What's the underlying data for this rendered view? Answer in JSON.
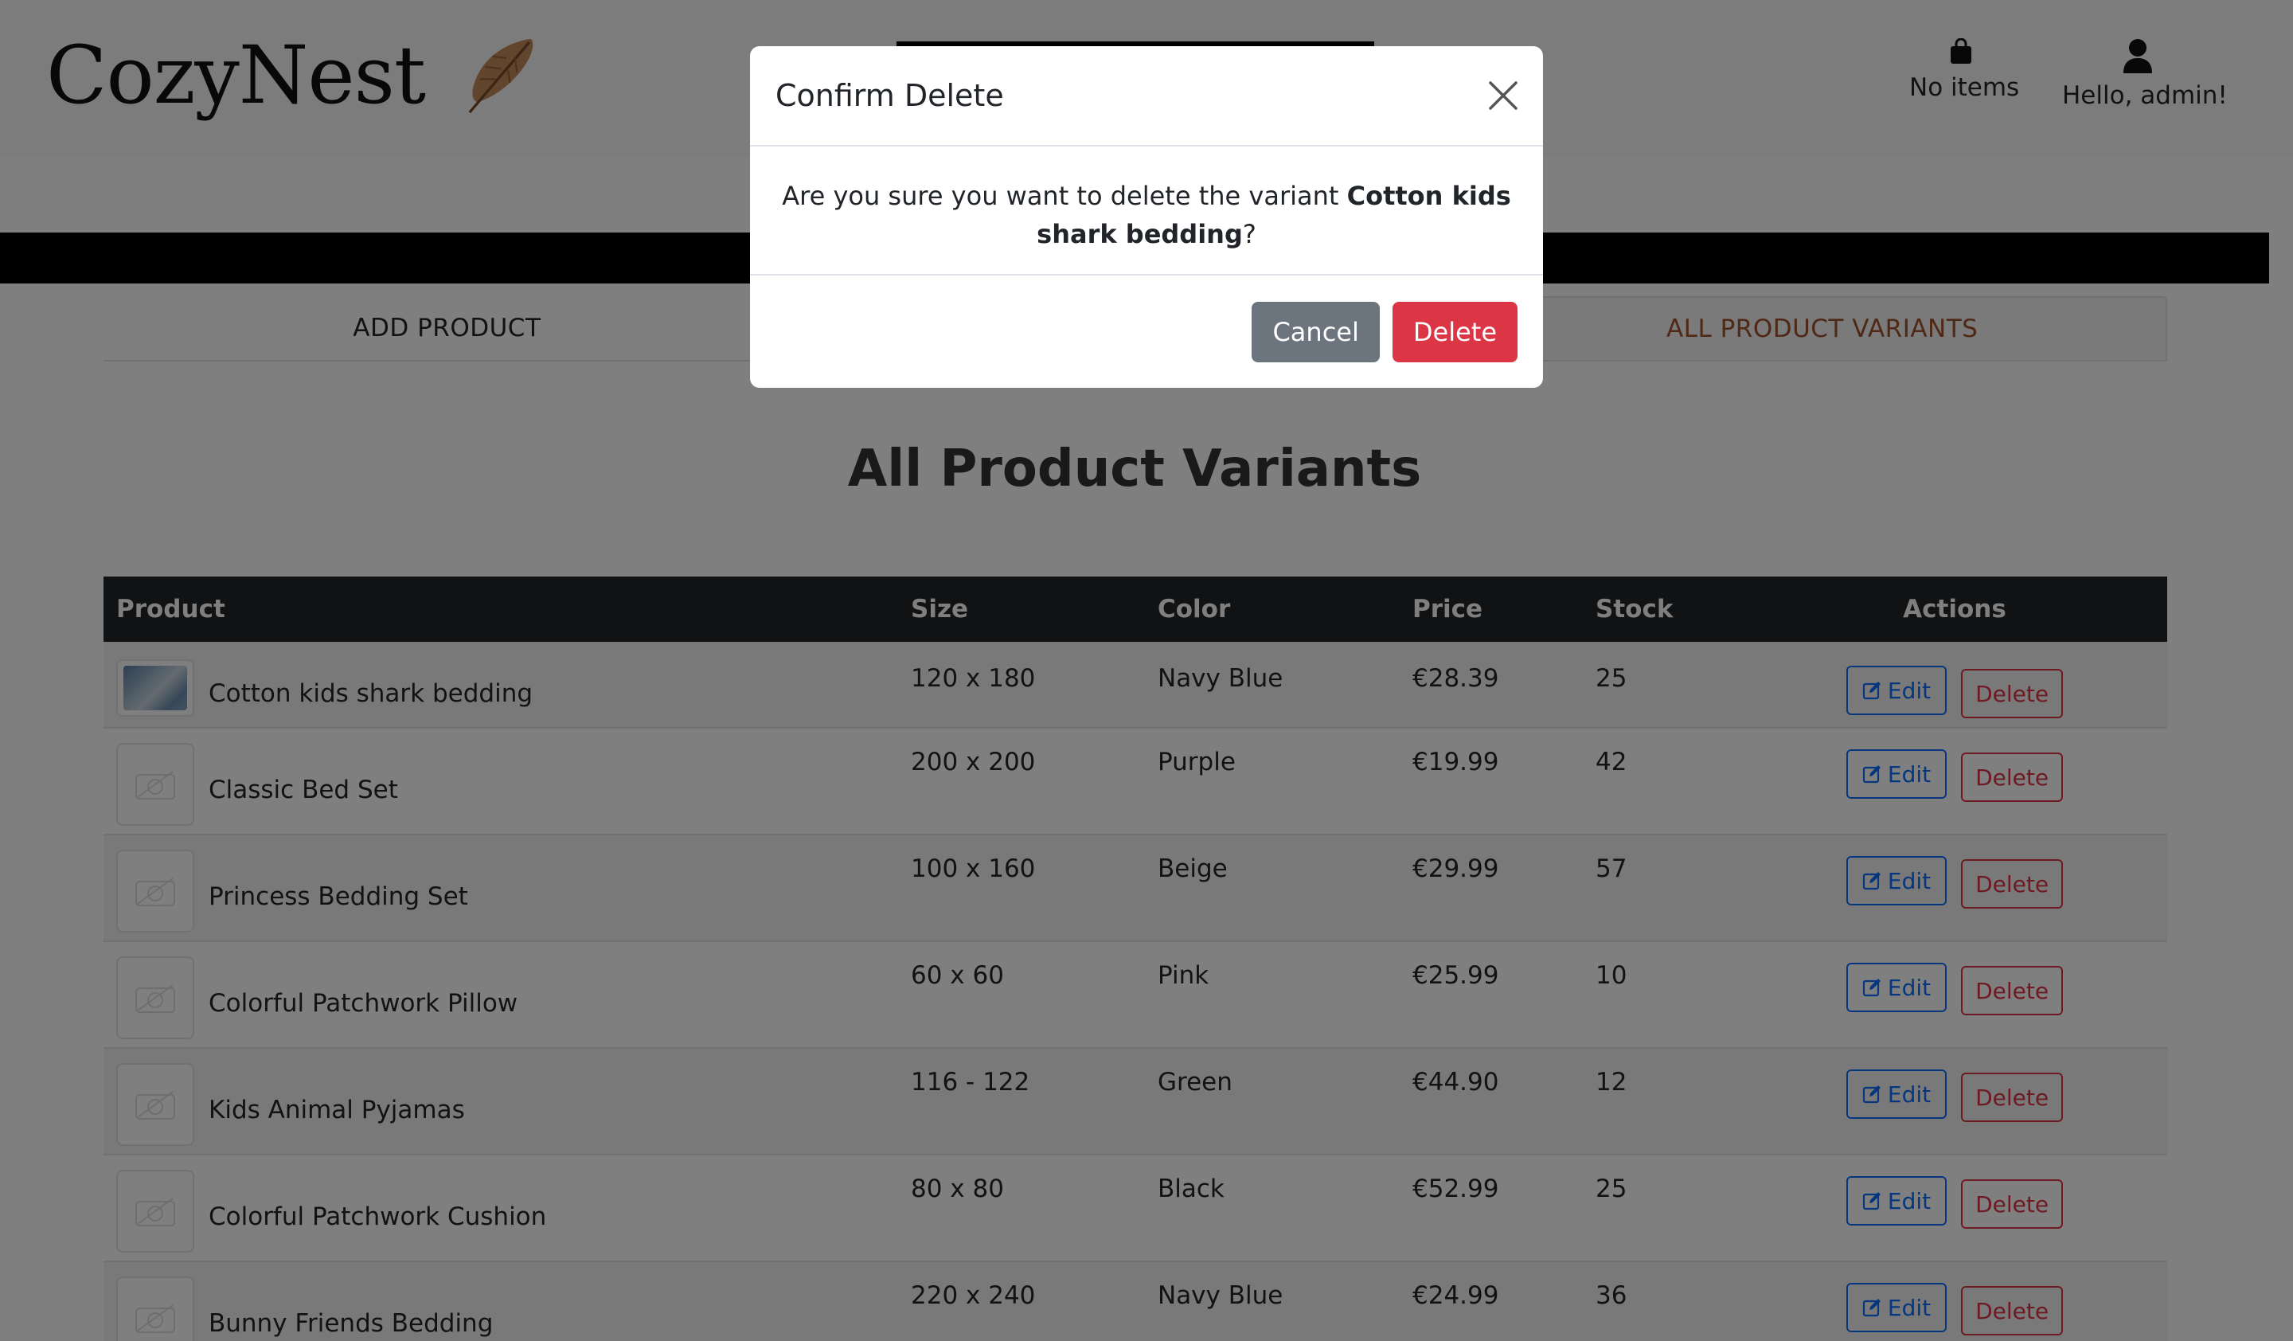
{
  "header": {
    "logo_text": "CozyNest",
    "cart_label": "No items",
    "user_label": "Hello, admin!"
  },
  "tabs": [
    {
      "label": "ADD PRODUCT",
      "active": false
    },
    {
      "label": "",
      "active": false
    },
    {
      "label": "ALL PRODUCT VARIANTS",
      "active": true
    }
  ],
  "page_title": "All Product Variants",
  "table": {
    "columns": [
      "Product",
      "Size",
      "Color",
      "Price",
      "Stock",
      "Actions"
    ],
    "rows": [
      {
        "product": "Cotton kids shark bedding",
        "size": "120 x 180",
        "color": "Navy Blue",
        "price": "€28.39",
        "stock": "25",
        "has_image": true
      },
      {
        "product": "Classic Bed Set",
        "size": "200 x 200",
        "color": "Purple",
        "price": "€19.99",
        "stock": "42",
        "has_image": false
      },
      {
        "product": "Princess Bedding Set",
        "size": "100 x 160",
        "color": "Beige",
        "price": "€29.99",
        "stock": "57",
        "has_image": false
      },
      {
        "product": "Colorful Patchwork Pillow",
        "size": "60 x 60",
        "color": "Pink",
        "price": "€25.99",
        "stock": "10",
        "has_image": false
      },
      {
        "product": "Kids Animal Pyjamas",
        "size": "116 - 122",
        "color": "Green",
        "price": "€44.90",
        "stock": "12",
        "has_image": false
      },
      {
        "product": "Colorful Patchwork Cushion",
        "size": "80 x 80",
        "color": "Black",
        "price": "€52.99",
        "stock": "25",
        "has_image": false
      },
      {
        "product": "Bunny Friends Bedding",
        "size": "220 x 240",
        "color": "Navy Blue",
        "price": "€24.99",
        "stock": "36",
        "has_image": false
      }
    ],
    "edit_label": "Edit",
    "delete_label": "Delete"
  },
  "modal": {
    "title": "Confirm Delete",
    "message_prefix": "Are you sure you want to delete the variant ",
    "message_variant": "Cotton kids shark bedding",
    "message_suffix": "?",
    "cancel_label": "Cancel",
    "confirm_label": "Delete"
  },
  "colors": {
    "accent": "#a0522d",
    "primary": "#0d6efd",
    "danger": "#dc3545",
    "secondary": "#6c757d",
    "table_header": "#212529"
  },
  "icons": {
    "cart": "shopping-bag-icon",
    "user": "user-icon",
    "edit": "pencil-square-icon",
    "close": "close-icon",
    "placeholder": "camera-icon",
    "logo": "feather-icon"
  }
}
